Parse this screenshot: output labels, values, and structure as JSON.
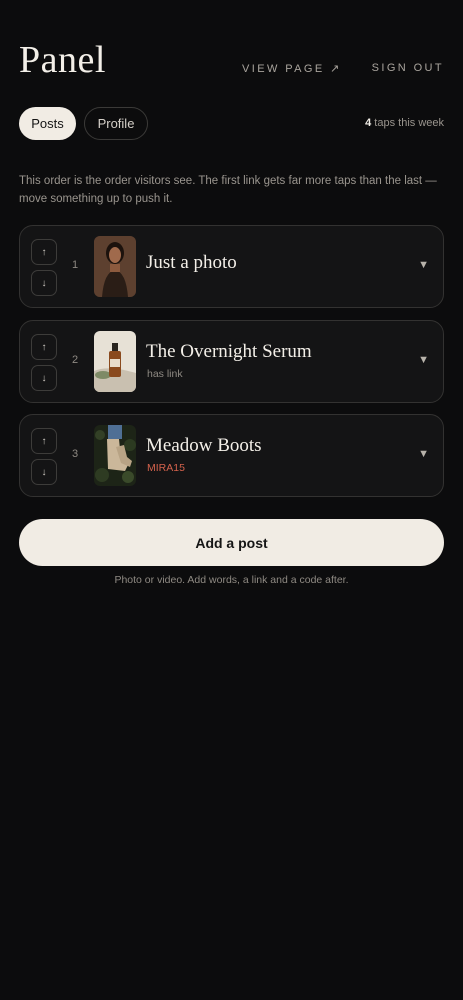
{
  "brand": "Panel",
  "nav": {
    "view_page": "VIEW PAGE ↗",
    "sign_out": "SIGN OUT"
  },
  "tabs": [
    {
      "label": "Posts",
      "active": true
    },
    {
      "label": "Profile",
      "active": false
    }
  ],
  "stats": {
    "count": "4",
    "label": "taps this week"
  },
  "hint": "This order is the order visitors see. The first link gets far more taps than the last — move something up to push it.",
  "posts": [
    {
      "position": "1",
      "title": "Just a photo",
      "subtitle": "",
      "thumb_icon": "portrait-photo"
    },
    {
      "position": "2",
      "title": "The Overnight Serum",
      "subtitle": "has link",
      "thumb_icon": "serum-bottle-photo"
    },
    {
      "position": "3",
      "title": "Meadow Boots",
      "subtitle": "MIRA15",
      "thumb_icon": "boots-photo"
    }
  ],
  "icons": {
    "up": "↑",
    "down": "↓",
    "expand": "▼"
  },
  "add": {
    "label": "Add a post",
    "note": "Photo or video. Add words, a link and a code after."
  },
  "colors": {
    "background": "#0c0c0d",
    "card": "#141415",
    "accent_light": "#f1ece4",
    "code": "#d4624c"
  }
}
